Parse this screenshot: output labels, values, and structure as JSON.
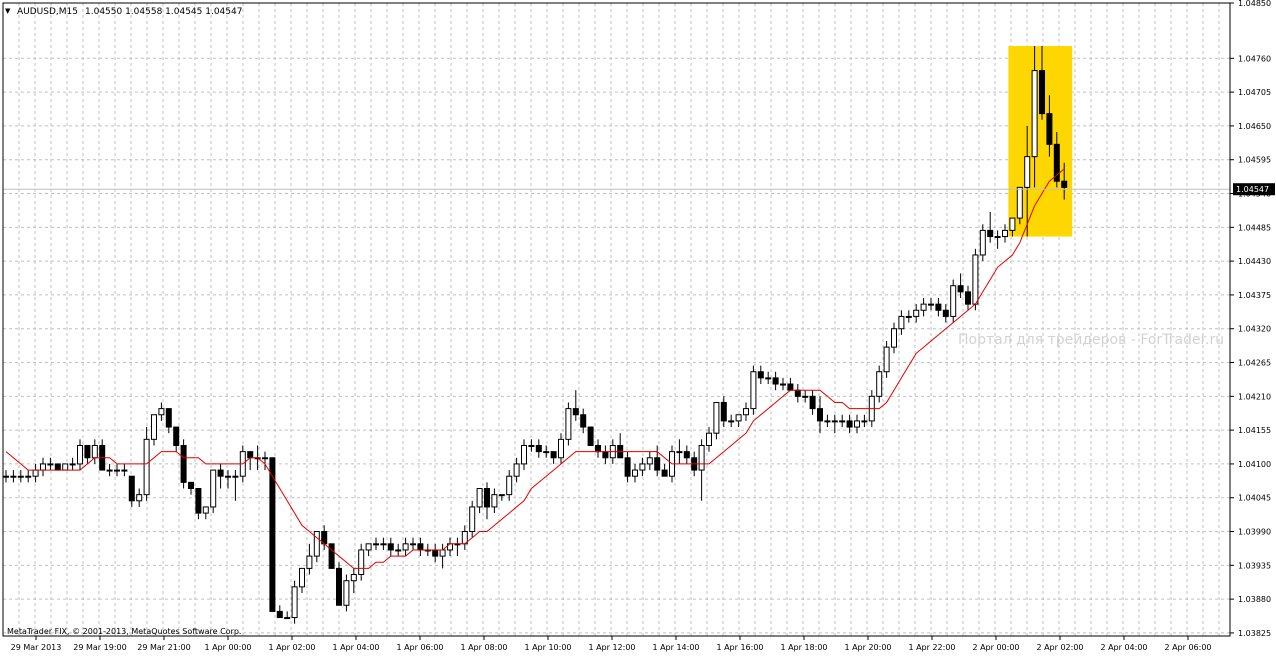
{
  "header": {
    "collapse_glyph": "▼",
    "symbol_label": "AUDUSD,M15",
    "ohlc": "1.04550 1.04558 1.04545 1.04547"
  },
  "watermark": "Портал для трейдеров - ForTrader.ru",
  "copyright": "MetaTrader FIX, © 2001-2013, MetaQuotes Software Corp.",
  "colors": {
    "background": "#ffffff",
    "grid": "#c0c0c0",
    "candle": "#000000",
    "moving_average": "#e00000",
    "highlight": "#ffd700",
    "price_line": "#c0c0c0",
    "current_price_box": "#000000"
  },
  "chart_data": {
    "type": "candlestick",
    "symbol": "AUDUSD",
    "timeframe": "M15",
    "grid": true,
    "ylim": [
      1.0382,
      1.0485
    ],
    "y_ticks": [
      "1.04850",
      "1.04760",
      "1.04705",
      "1.04650",
      "1.04595",
      "1.04540",
      "1.04485",
      "1.04430",
      "1.04375",
      "1.04320",
      "1.04265",
      "1.04210",
      "1.04155",
      "1.04100",
      "1.04045",
      "1.03990",
      "1.03935",
      "1.03880",
      "1.03825"
    ],
    "x_ticks": [
      "29 Mar 2013",
      "29 Mar 19:00",
      "29 Mar 21:00",
      "1 Apr 00:00",
      "1 Apr 02:00",
      "1 Apr 04:00",
      "1 Apr 06:00",
      "1 Apr 08:00",
      "1 Apr 10:00",
      "1 Apr 12:00",
      "1 Apr 14:00",
      "1 Apr 16:00",
      "1 Apr 18:00",
      "1 Apr 20:00",
      "1 Apr 22:00",
      "2 Apr 00:00",
      "2 Apr 02:00",
      "2 Apr 04:00",
      "2 Apr 06:00"
    ],
    "current_price": "1.04547",
    "highlight_range": [
      1.0447,
      1.0478
    ],
    "candles": [
      [
        1.0408,
        1.0409,
        1.0407,
        1.0408
      ],
      [
        1.0408,
        1.0409,
        1.0407,
        1.0408
      ],
      [
        1.0408,
        1.0409,
        1.0407,
        1.0408
      ],
      [
        1.0408,
        1.0409,
        1.0407,
        1.0408
      ],
      [
        1.0408,
        1.041,
        1.0407,
        1.0409
      ],
      [
        1.0409,
        1.0411,
        1.0408,
        1.041
      ],
      [
        1.041,
        1.0411,
        1.0409,
        1.041
      ],
      [
        1.041,
        1.041,
        1.0409,
        1.0409
      ],
      [
        1.0409,
        1.041,
        1.0409,
        1.041
      ],
      [
        1.041,
        1.0411,
        1.0409,
        1.041
      ],
      [
        1.041,
        1.0414,
        1.0409,
        1.0413
      ],
      [
        1.0413,
        1.0413,
        1.041,
        1.0411
      ],
      [
        1.0411,
        1.0414,
        1.041,
        1.0413
      ],
      [
        1.0413,
        1.0414,
        1.0409,
        1.0409
      ],
      [
        1.0409,
        1.041,
        1.0408,
        1.0409
      ],
      [
        1.0409,
        1.041,
        1.0408,
        1.0409
      ],
      [
        1.0409,
        1.041,
        1.0408,
        1.0409
      ],
      [
        1.0408,
        1.0408,
        1.0403,
        1.0404
      ],
      [
        1.0404,
        1.0406,
        1.0403,
        1.0405
      ],
      [
        1.0405,
        1.0416,
        1.0404,
        1.0414
      ],
      [
        1.0414,
        1.0418,
        1.0413,
        1.0418
      ],
      [
        1.0418,
        1.042,
        1.0417,
        1.0419
      ],
      [
        1.0419,
        1.0419,
        1.0415,
        1.0416
      ],
      [
        1.0416,
        1.0416,
        1.0412,
        1.0413
      ],
      [
        1.0413,
        1.0414,
        1.0406,
        1.0407
      ],
      [
        1.0407,
        1.0407,
        1.0405,
        1.0406
      ],
      [
        1.0406,
        1.0406,
        1.0401,
        1.0402
      ],
      [
        1.0402,
        1.0403,
        1.0401,
        1.0403
      ],
      [
        1.0403,
        1.0409,
        1.0402,
        1.0409
      ],
      [
        1.0409,
        1.041,
        1.0406,
        1.0408
      ],
      [
        1.0408,
        1.0409,
        1.0406,
        1.0408
      ],
      [
        1.0408,
        1.0409,
        1.0404,
        1.0408
      ],
      [
        1.0408,
        1.0413,
        1.0407,
        1.0412
      ],
      [
        1.0412,
        1.0412,
        1.0409,
        1.0411
      ],
      [
        1.0411,
        1.0413,
        1.0409,
        1.0411
      ],
      [
        1.0411,
        1.0412,
        1.0409,
        1.0411
      ],
      [
        1.0411,
        1.0411,
        1.039,
        1.0386
      ],
      [
        1.0386,
        1.0387,
        1.0385,
        1.0385
      ],
      [
        1.0385,
        1.0386,
        1.0385,
        1.0385
      ],
      [
        1.0385,
        1.0391,
        1.0384,
        1.039
      ],
      [
        1.039,
        1.0393,
        1.0389,
        1.0393
      ],
      [
        1.0393,
        1.0397,
        1.0392,
        1.0395
      ],
      [
        1.0395,
        1.0399,
        1.0394,
        1.0399
      ],
      [
        1.0399,
        1.04,
        1.0396,
        1.0397
      ],
      [
        1.0397,
        1.0397,
        1.0393,
        1.0393
      ],
      [
        1.0393,
        1.0394,
        1.0387,
        1.0387
      ],
      [
        1.0387,
        1.0392,
        1.0386,
        1.0391
      ],
      [
        1.0391,
        1.0393,
        1.0389,
        1.0392
      ],
      [
        1.0392,
        1.0397,
        1.0391,
        1.0396
      ],
      [
        1.0396,
        1.0397,
        1.0395,
        1.0397
      ],
      [
        1.0397,
        1.0398,
        1.0396,
        1.0397
      ],
      [
        1.0397,
        1.0398,
        1.0396,
        1.0397
      ],
      [
        1.0397,
        1.0398,
        1.0395,
        1.0396
      ],
      [
        1.0396,
        1.0397,
        1.0395,
        1.0396
      ],
      [
        1.0396,
        1.0398,
        1.0395,
        1.0397
      ],
      [
        1.0397,
        1.0398,
        1.0396,
        1.0397
      ],
      [
        1.0397,
        1.0398,
        1.0395,
        1.0396
      ],
      [
        1.0396,
        1.0397,
        1.0395,
        1.0396
      ],
      [
        1.0396,
        1.0397,
        1.0394,
        1.0395
      ],
      [
        1.0395,
        1.0397,
        1.0393,
        1.0396
      ],
      [
        1.0396,
        1.0398,
        1.0395,
        1.0397
      ],
      [
        1.0397,
        1.0398,
        1.0395,
        1.0397
      ],
      [
        1.0397,
        1.04,
        1.0396,
        1.0399
      ],
      [
        1.0399,
        1.0404,
        1.0398,
        1.0403
      ],
      [
        1.0403,
        1.0406,
        1.0402,
        1.0406
      ],
      [
        1.0406,
        1.0407,
        1.0401,
        1.0403
      ],
      [
        1.0403,
        1.0406,
        1.0402,
        1.0405
      ],
      [
        1.0405,
        1.0405,
        1.0404,
        1.0405
      ],
      [
        1.0405,
        1.0409,
        1.0404,
        1.0408
      ],
      [
        1.0408,
        1.0411,
        1.0407,
        1.041
      ],
      [
        1.041,
        1.0414,
        1.0409,
        1.0413
      ],
      [
        1.0413,
        1.0414,
        1.0412,
        1.0413
      ],
      [
        1.0413,
        1.0414,
        1.0411,
        1.0412
      ],
      [
        1.0412,
        1.0413,
        1.0411,
        1.0412
      ],
      [
        1.0412,
        1.0412,
        1.041,
        1.0411
      ],
      [
        1.0411,
        1.0415,
        1.041,
        1.0414
      ],
      [
        1.0414,
        1.042,
        1.0413,
        1.0419
      ],
      [
        1.0419,
        1.0422,
        1.0417,
        1.0418
      ],
      [
        1.0418,
        1.0419,
        1.0415,
        1.0416
      ],
      [
        1.0416,
        1.0416,
        1.0413,
        1.0413
      ],
      [
        1.0413,
        1.0414,
        1.0411,
        1.0412
      ],
      [
        1.0412,
        1.0413,
        1.041,
        1.0411
      ],
      [
        1.0411,
        1.0414,
        1.041,
        1.0413
      ],
      [
        1.0413,
        1.0415,
        1.0411,
        1.0411
      ],
      [
        1.0411,
        1.0412,
        1.0407,
        1.0408
      ],
      [
        1.0408,
        1.041,
        1.0407,
        1.0409
      ],
      [
        1.0409,
        1.0411,
        1.0408,
        1.041
      ],
      [
        1.041,
        1.0412,
        1.0409,
        1.0411
      ],
      [
        1.0411,
        1.0413,
        1.0408,
        1.0409
      ],
      [
        1.0409,
        1.041,
        1.0408,
        1.0408
      ],
      [
        1.0408,
        1.0413,
        1.0407,
        1.0412
      ],
      [
        1.0412,
        1.0414,
        1.041,
        1.0412
      ],
      [
        1.0412,
        1.0413,
        1.041,
        1.0411
      ],
      [
        1.0411,
        1.0412,
        1.0408,
        1.0409
      ],
      [
        1.0409,
        1.0414,
        1.0404,
        1.0413
      ],
      [
        1.0413,
        1.0416,
        1.0412,
        1.0415
      ],
      [
        1.0415,
        1.042,
        1.0414,
        1.042
      ],
      [
        1.042,
        1.0421,
        1.0416,
        1.0417
      ],
      [
        1.0417,
        1.0418,
        1.0416,
        1.0417
      ],
      [
        1.0417,
        1.0418,
        1.0416,
        1.0418
      ],
      [
        1.0418,
        1.042,
        1.0417,
        1.0419
      ],
      [
        1.0419,
        1.0426,
        1.0418,
        1.0425
      ],
      [
        1.0425,
        1.0426,
        1.0423,
        1.0424
      ],
      [
        1.0424,
        1.0425,
        1.0423,
        1.0424
      ],
      [
        1.0424,
        1.0425,
        1.0422,
        1.0423
      ],
      [
        1.0423,
        1.0424,
        1.0422,
        1.0423
      ],
      [
        1.0423,
        1.0424,
        1.0422,
        1.0422
      ],
      [
        1.0422,
        1.0423,
        1.042,
        1.0421
      ],
      [
        1.0421,
        1.0422,
        1.042,
        1.0421
      ],
      [
        1.0421,
        1.0422,
        1.0418,
        1.0419
      ],
      [
        1.0419,
        1.0421,
        1.0415,
        1.0417
      ],
      [
        1.0417,
        1.0418,
        1.0416,
        1.0417
      ],
      [
        1.0417,
        1.0418,
        1.0415,
        1.0417
      ],
      [
        1.0417,
        1.0418,
        1.0416,
        1.0417
      ],
      [
        1.0417,
        1.0418,
        1.0415,
        1.0416
      ],
      [
        1.0416,
        1.0418,
        1.0415,
        1.0417
      ],
      [
        1.0417,
        1.0418,
        1.0416,
        1.0417
      ],
      [
        1.0417,
        1.0422,
        1.0416,
        1.0421
      ],
      [
        1.0421,
        1.0426,
        1.042,
        1.0425
      ],
      [
        1.0425,
        1.043,
        1.0424,
        1.0429
      ],
      [
        1.0429,
        1.0433,
        1.0428,
        1.0432
      ],
      [
        1.0432,
        1.0435,
        1.0431,
        1.0434
      ],
      [
        1.0434,
        1.0435,
        1.0433,
        1.0434
      ],
      [
        1.0434,
        1.0436,
        1.0433,
        1.0435
      ],
      [
        1.0435,
        1.0437,
        1.0434,
        1.0436
      ],
      [
        1.0436,
        1.0437,
        1.0435,
        1.0436
      ],
      [
        1.0436,
        1.0437,
        1.0434,
        1.0435
      ],
      [
        1.0435,
        1.0436,
        1.0433,
        1.0434
      ],
      [
        1.0434,
        1.044,
        1.0433,
        1.0439
      ],
      [
        1.0439,
        1.0441,
        1.0437,
        1.0438
      ],
      [
        1.0438,
        1.0439,
        1.0435,
        1.0436
      ],
      [
        1.0436,
        1.0445,
        1.0435,
        1.0444
      ],
      [
        1.0444,
        1.0449,
        1.0443,
        1.0448
      ],
      [
        1.0448,
        1.0451,
        1.0446,
        1.0447
      ],
      [
        1.0447,
        1.0448,
        1.0445,
        1.0447
      ],
      [
        1.0447,
        1.0449,
        1.0446,
        1.0448
      ],
      [
        1.0448,
        1.045,
        1.0447,
        1.045
      ],
      [
        1.045,
        1.0455,
        1.0449,
        1.0455
      ],
      [
        1.0455,
        1.0465,
        1.0447,
        1.046
      ],
      [
        1.046,
        1.0478,
        1.0455,
        1.0474
      ],
      [
        1.0474,
        1.0478,
        1.0466,
        1.0467
      ],
      [
        1.0467,
        1.047,
        1.046,
        1.0462
      ],
      [
        1.0462,
        1.0464,
        1.0455,
        1.0456
      ],
      [
        1.0456,
        1.0459,
        1.0453,
        1.0455
      ]
    ],
    "moving_average": [
      1.0412,
      1.0411,
      1.041,
      1.0409,
      1.0409,
      1.0409,
      1.0409,
      1.0409,
      1.0409,
      1.0409,
      1.0409,
      1.041,
      1.0411,
      1.0411,
      1.0411,
      1.041,
      1.041,
      1.041,
      1.041,
      1.041,
      1.0411,
      1.0412,
      1.0412,
      1.0412,
      1.0411,
      1.0411,
      1.0411,
      1.041,
      1.041,
      1.041,
      1.041,
      1.041,
      1.041,
      1.0411,
      1.0411,
      1.041,
      1.0408,
      1.0406,
      1.0404,
      1.0402,
      1.04,
      1.0399,
      1.0398,
      1.0397,
      1.0396,
      1.0395,
      1.0394,
      1.0393,
      1.0393,
      1.0393,
      1.0394,
      1.0394,
      1.0395,
      1.0395,
      1.0395,
      1.0396,
      1.0396,
      1.0396,
      1.0396,
      1.0396,
      1.0397,
      1.0397,
      1.0397,
      1.0398,
      1.0399,
      1.0399,
      1.04,
      1.0401,
      1.0402,
      1.0403,
      1.0404,
      1.0406,
      1.0407,
      1.0408,
      1.0409,
      1.041,
      1.0411,
      1.0412,
      1.0412,
      1.0412,
      1.0412,
      1.0412,
      1.0412,
      1.0412,
      1.0412,
      1.0412,
      1.0412,
      1.0412,
      1.0412,
      1.0411,
      1.041,
      1.041,
      1.041,
      1.041,
      1.041,
      1.041,
      1.0411,
      1.0412,
      1.0413,
      1.0414,
      1.0415,
      1.0417,
      1.0418,
      1.0419,
      1.042,
      1.0421,
      1.0422,
      1.0422,
      1.0422,
      1.0422,
      1.0422,
      1.0421,
      1.042,
      1.042,
      1.0419,
      1.0419,
      1.0419,
      1.0419,
      1.0419,
      1.042,
      1.0422,
      1.0424,
      1.0426,
      1.0428,
      1.0429,
      1.043,
      1.0431,
      1.0432,
      1.0433,
      1.0434,
      1.0435,
      1.0436,
      1.0438,
      1.044,
      1.0442,
      1.0443,
      1.0444,
      1.0446,
      1.0449,
      1.0452,
      1.0454,
      1.0456,
      1.0457,
      1.0458
    ]
  }
}
